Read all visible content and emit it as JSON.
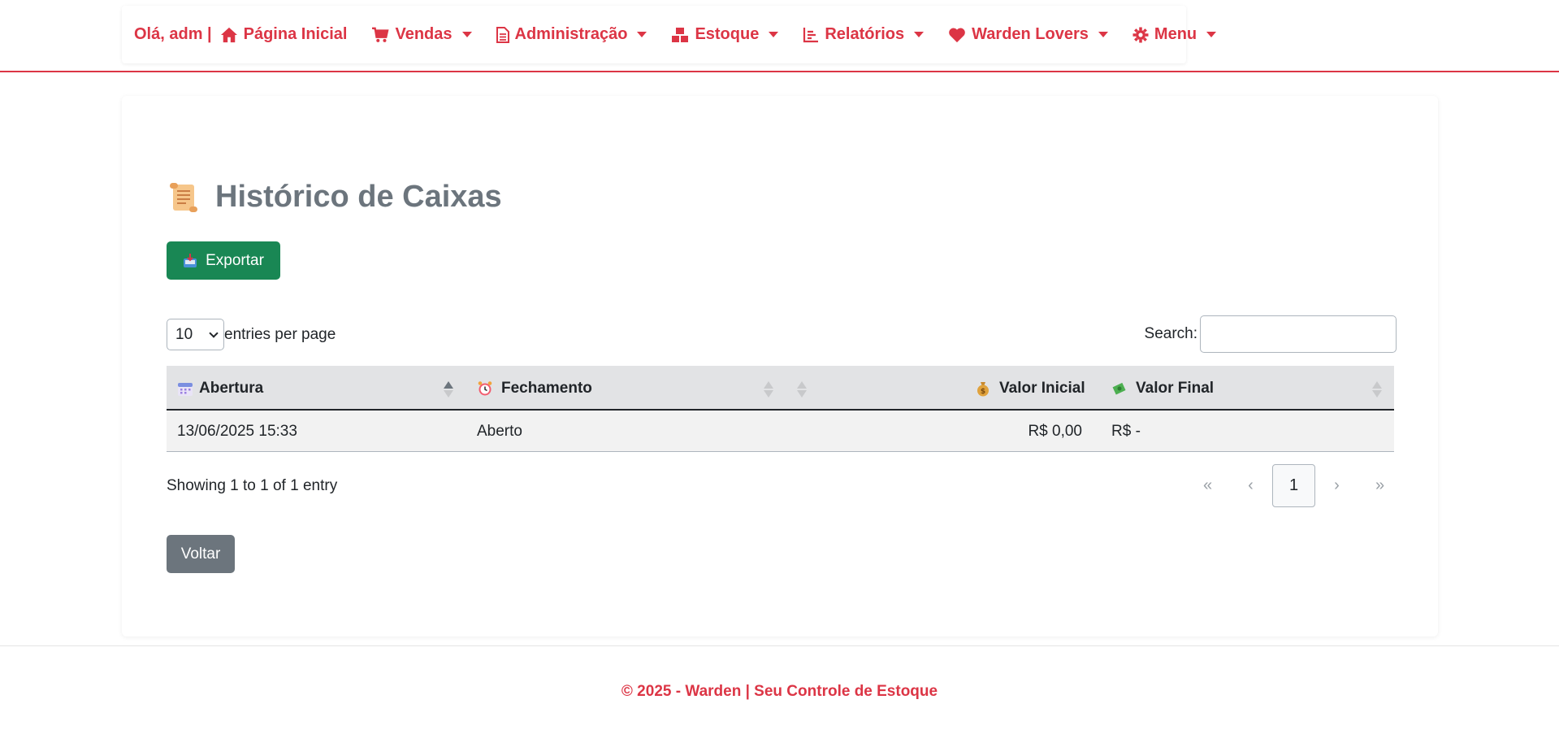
{
  "nav": {
    "greeting": "Olá, adm |",
    "items": [
      {
        "label": "Página Inicial",
        "icon": "home-icon",
        "dropdown": false
      },
      {
        "label": "Vendas",
        "icon": "cart-icon",
        "dropdown": true
      },
      {
        "label": "Administração",
        "icon": "document-icon",
        "dropdown": true
      },
      {
        "label": "Estoque",
        "icon": "boxes-icon",
        "dropdown": true
      },
      {
        "label": "Relatórios",
        "icon": "bar-chart-icon",
        "dropdown": true
      },
      {
        "label": "Warden Lovers",
        "icon": "heart-icon",
        "dropdown": true
      },
      {
        "label": "Menu",
        "icon": "gear-icon",
        "dropdown": true
      }
    ]
  },
  "page": {
    "title": "Histórico de Caixas",
    "title_icon": "scroll-icon",
    "export_label": "Exportar",
    "back_label": "Voltar"
  },
  "table_controls": {
    "page_size": "10",
    "entries_label": "entries per page",
    "search_label": "Search:",
    "search_value": ""
  },
  "table": {
    "columns": [
      {
        "label": "Abertura",
        "icon": "calendar-icon"
      },
      {
        "label": "Fechamento",
        "icon": "alarm-clock-icon"
      },
      {
        "label": "",
        "icon": ""
      },
      {
        "label": "Valor Inicial",
        "icon": "money-bag-icon"
      },
      {
        "label": "Valor Final",
        "icon": "money-wings-icon"
      }
    ],
    "rows": [
      {
        "abertura": "13/06/2025 15:33",
        "fechamento": "Aberto",
        "valor_inicial": "R$ 0,00",
        "valor_final": "R$ -"
      }
    ]
  },
  "pagination": {
    "info": "Showing 1 to 1 of 1 entry",
    "first": "«",
    "prev": "‹",
    "current": "1",
    "next": "›",
    "last": "»"
  },
  "footer": {
    "text": "© 2025 - Warden | Seu Controle de Estoque"
  },
  "colors": {
    "accent": "#dc3545",
    "export_button": "#198754",
    "back_button": "#6c757d",
    "table_header": "#e2e3e5"
  }
}
